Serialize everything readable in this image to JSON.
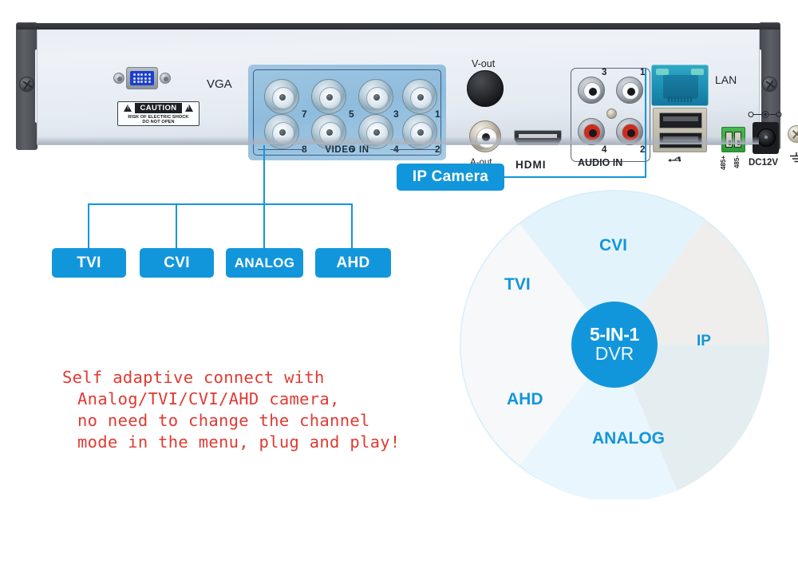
{
  "device": {
    "name": "5-IN-1 DVR rear panel",
    "ports": {
      "vga_label": "VGA",
      "caution": {
        "title": "CAUTION",
        "line1": "RISK OF ELECTRIC SHOCK",
        "line2": "DO NOT OPEN",
        "warning_icon": "warning-triangle-icon"
      },
      "video_in_label": "VIDEO IN",
      "video_in_channels": [
        "7",
        "5",
        "3",
        "1",
        "8",
        "6",
        "4",
        "2"
      ],
      "vout_label": "V-out",
      "aout_label": "A-out",
      "hdmi_label": "HDMI",
      "audio_in_label": "AUDIO IN",
      "audio_in_channels": [
        "3",
        "1",
        "4",
        "2"
      ],
      "lan_label": "LAN",
      "usb_icon": "usb-icon",
      "rs485_a_label": "485+",
      "rs485_b_label": "485-",
      "dc_label": "DC12V",
      "ground_icon": "ground-icon",
      "polarity_icon": "dc-polarity-icon"
    }
  },
  "callouts": {
    "signal_types": [
      {
        "label": "TVI"
      },
      {
        "label": "CVI"
      },
      {
        "label": "ANALOG"
      },
      {
        "label": "AHD"
      }
    ],
    "ip_camera": "IP Camera"
  },
  "chart_data": {
    "type": "pie",
    "title": "5-IN-1 DVR",
    "center_label_top": "5-IN-1",
    "center_label_bottom": "DVR",
    "categories": [
      "CVI",
      "IP",
      "ANALOG",
      "AHD",
      "TVI"
    ],
    "values": [
      20,
      20,
      20,
      20,
      20
    ],
    "colors": [
      "#e3f3fb",
      "#efeeec",
      "#e4eef1",
      "#eaf6fd",
      "#f7f8f9"
    ],
    "label_color": "#1296db",
    "ring_color": "#d8eefb",
    "legend": "none",
    "xlabel": "",
    "ylabel": ""
  },
  "note": {
    "lines": [
      "Self adaptive connect with",
      "Analog/TVI/CVI/AHD camera,",
      "no need to change the channel",
      "mode in the menu, plug and play!"
    ],
    "color": "#e03a32"
  }
}
